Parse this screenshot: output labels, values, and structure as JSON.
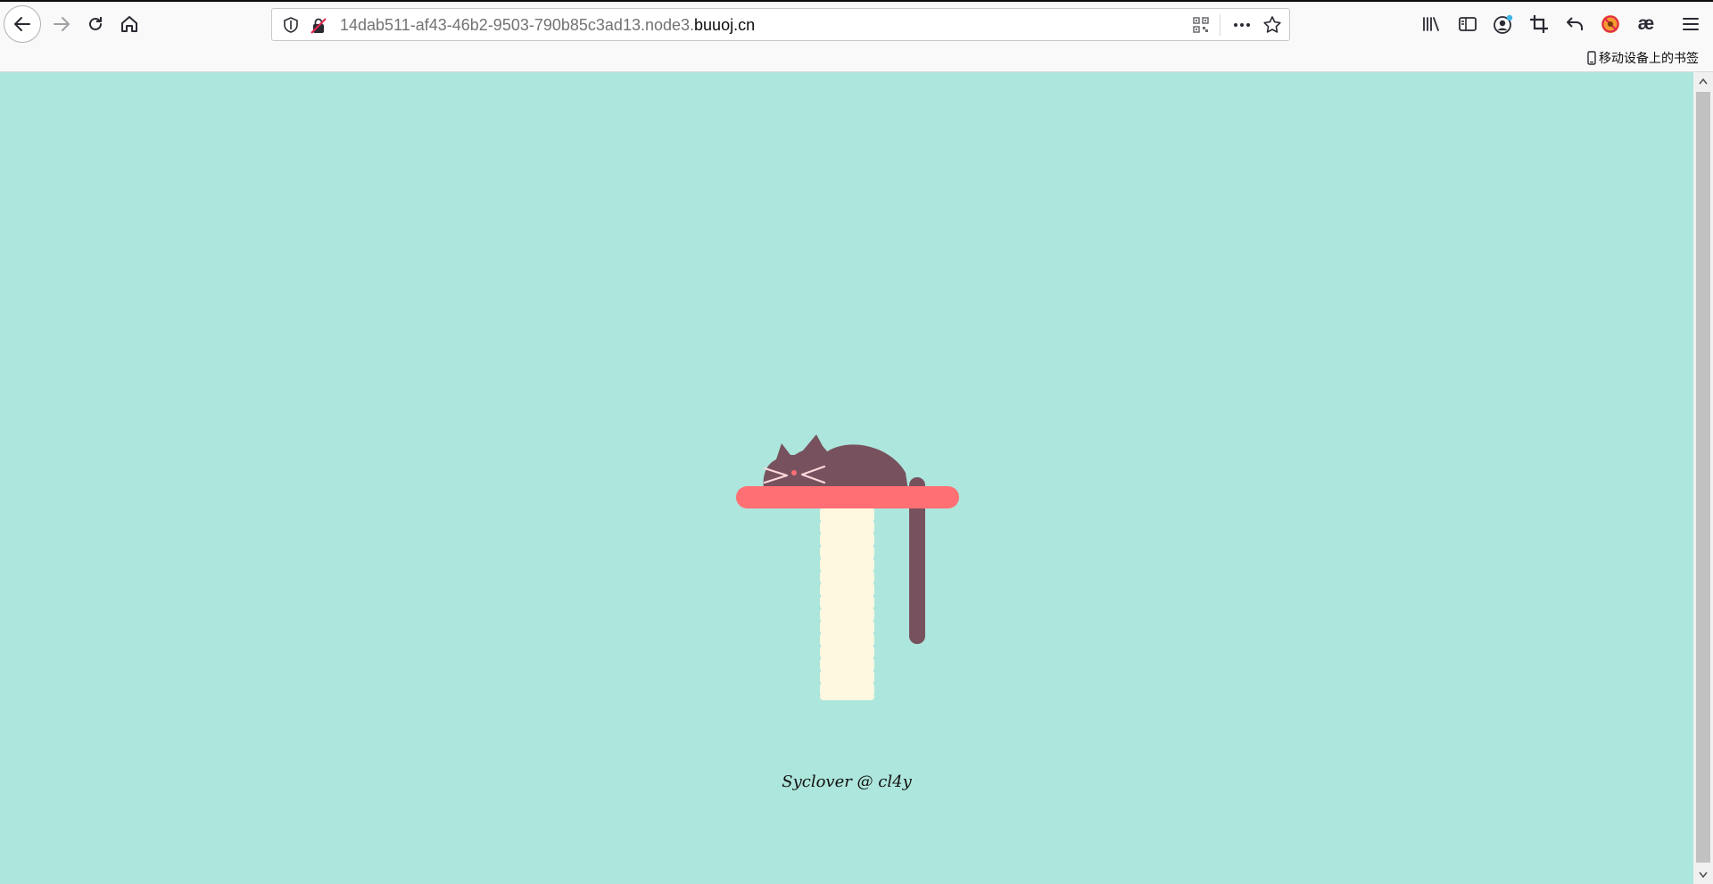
{
  "browser": {
    "url_prefix": "14dab511-af43-46b2-9503-790b85c3ad13.node3.",
    "url_domain": "buuoj.cn",
    "bookmark_folder_label": "移动设备上的书签",
    "toolbar_icons": [
      "library-icon",
      "sidebar-icon",
      "account-icon",
      "crop-icon",
      "undo-icon",
      "blocked-icon",
      "ae-extension-icon",
      "menu-icon"
    ],
    "ae_label": "æ"
  },
  "page": {
    "credit": "Syclover @ cl4y",
    "colors": {
      "background": "#ade6dc",
      "cat": "#77525e",
      "shelf": "#ff6f73",
      "post": "#fff8e1"
    }
  }
}
